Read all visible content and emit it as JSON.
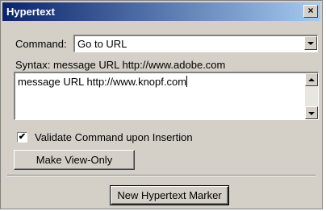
{
  "window": {
    "title": "Hypertext",
    "close_glyph": "×"
  },
  "command": {
    "label": "Command:",
    "selected": "Go to URL"
  },
  "syntax": {
    "text": "Syntax:  message URL http://www.adobe.com"
  },
  "editor": {
    "value": "message URL http://www.knopf.com"
  },
  "validate": {
    "label": "Validate Command upon Insertion",
    "checked": true,
    "check_glyph": "✔"
  },
  "buttons": {
    "make_view_only": "Make View-Only",
    "new_marker": "New Hypertext Marker"
  },
  "icons": {
    "close": "close-icon",
    "dropdown": "chevron-down-icon",
    "scroll_up": "scroll-up-icon",
    "scroll_down": "scroll-down-icon",
    "check": "checkmark-icon"
  },
  "colors": {
    "title_start": "#0a246a",
    "title_end": "#a6caf0",
    "face": "#d4d0c8"
  }
}
